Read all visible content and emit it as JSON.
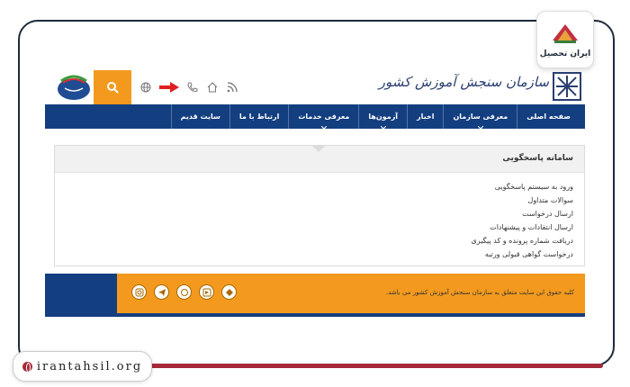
{
  "badge": {
    "text": "ایران تحصیل"
  },
  "watermark": {
    "url": "irantahsil.org"
  },
  "site": {
    "title": "سازمان سنجش آموزش کشور",
    "nav": [
      {
        "label": "صفحه اصلی",
        "has_sub": false
      },
      {
        "label": "معرفی سازمان",
        "has_sub": true
      },
      {
        "label": "اخبار",
        "has_sub": false
      },
      {
        "label": "آزمون‌ها",
        "has_sub": true
      },
      {
        "label": "معرفی خدمات",
        "has_sub": true
      },
      {
        "label": "ارتباط با ما",
        "has_sub": false
      },
      {
        "label": "سایت قدیم",
        "has_sub": false
      }
    ],
    "panel": {
      "title": "سامانه پاسخگویی",
      "items": [
        "ورود به سیستم پاسخگویی",
        "سوالات متداول",
        "ارسال درخواست",
        "ارسال انتقادات و پیشنهادات",
        "دریافت شماره پرونده و کد پیگیری",
        "درخواست گواهی قبولی ورتبه"
      ]
    },
    "footer": {
      "copyright": "کلیه حقوق این سایت متعلق به سازمان سنجش آموزش کشور می باشد."
    }
  },
  "icons": {
    "header": [
      "rss-icon",
      "home-icon",
      "phone-icon",
      "arrow-icon",
      "globe-icon"
    ],
    "social": [
      "instagram-icon",
      "telegram-icon",
      "eitaa-icon",
      "aparat-icon",
      "rubika-icon"
    ]
  },
  "colors": {
    "navy": "#133e80",
    "orange": "#f39a1e",
    "accent": "#a52a3a",
    "arrow": "#e02020"
  }
}
